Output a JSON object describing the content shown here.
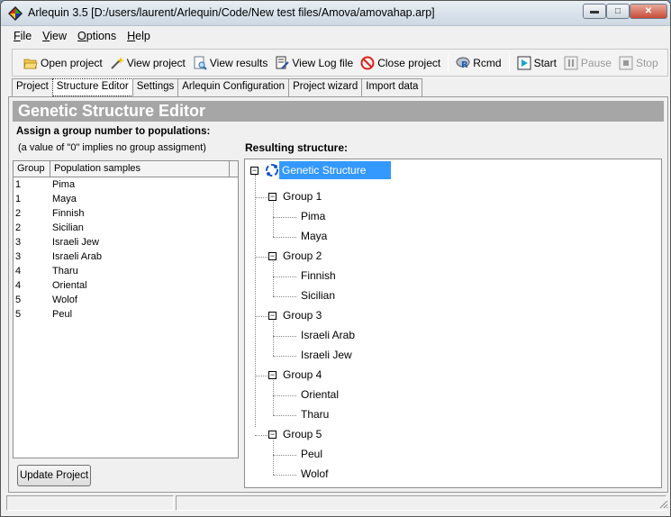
{
  "window": {
    "title": "Arlequin 3.5 [D:/users/laurent/Arlequin/Code/New test files/Amova/amovahap.arp]",
    "minimize_icon": "minimize-icon",
    "maximize_icon": "maximize-icon",
    "close_icon": "close-icon"
  },
  "menu": [
    {
      "key": "F",
      "rest": "ile"
    },
    {
      "key": "V",
      "rest": "iew"
    },
    {
      "key": "O",
      "rest": "ptions"
    },
    {
      "key": "H",
      "rest": "elp"
    }
  ],
  "toolbar": {
    "open_project": "Open project",
    "view_project": "View project",
    "view_results": "View results",
    "view_log": "View Log file",
    "close_project": "Close project",
    "rcmd": "Rcmd",
    "start": "Start",
    "pause": "Pause",
    "stop": "Stop"
  },
  "tabs": [
    "Project",
    "Structure Editor",
    "Settings",
    "Arlequin Configuration",
    "Project wizard",
    "Import data"
  ],
  "active_tab": "Structure Editor",
  "editor": {
    "header": "Genetic Structure Editor",
    "assign_label": "Assign a group number to populations:",
    "hint": "(a value of \"0\" implies no group assigment)",
    "result_label": "Resulting structure:",
    "update_button": "Update Project"
  },
  "grid": {
    "columns": [
      "Group",
      "Population samples"
    ],
    "rows": [
      {
        "group": "1",
        "population": "Pima"
      },
      {
        "group": "1",
        "population": "Maya"
      },
      {
        "group": "2",
        "population": "Finnish"
      },
      {
        "group": "2",
        "population": "Sicilian"
      },
      {
        "group": "3",
        "population": "Israeli Jew"
      },
      {
        "group": "3",
        "population": "Israeli Arab"
      },
      {
        "group": "4",
        "population": "Tharu"
      },
      {
        "group": "4",
        "population": "Oriental"
      },
      {
        "group": "5",
        "population": "Wolof"
      },
      {
        "group": "5",
        "population": "Peul"
      }
    ]
  },
  "tree": {
    "root": "Genetic Structure",
    "groups": [
      {
        "name": "Group 1",
        "children": [
          "Pima",
          "Maya"
        ]
      },
      {
        "name": "Group 2",
        "children": [
          "Finnish",
          "Sicilian"
        ]
      },
      {
        "name": "Group 3",
        "children": [
          "Israeli Arab",
          "Israeli Jew"
        ]
      },
      {
        "name": "Group 4",
        "children": [
          "Oriental",
          "Tharu"
        ]
      },
      {
        "name": "Group 5",
        "children": [
          "Peul",
          "Wolof"
        ]
      }
    ],
    "expander_symbol": "−"
  },
  "colors": {
    "selection": "#3399ff",
    "header_bar": "#a6a6a6"
  }
}
